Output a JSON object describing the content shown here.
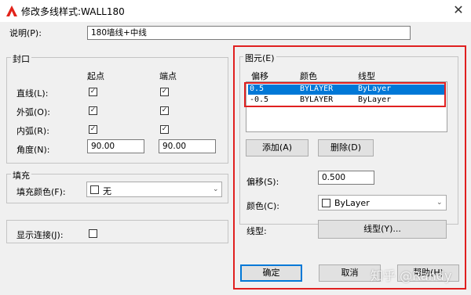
{
  "window": {
    "title": "修改多线样式:WALL180",
    "close_glyph": "✕"
  },
  "description": {
    "label": "说明(P):",
    "value": "180墙线+中线"
  },
  "caps": {
    "group_label": "封口",
    "col_start": "起点",
    "col_end": "端点",
    "rows": [
      {
        "label": "直线(L):",
        "start": true,
        "end": true
      },
      {
        "label": "外弧(O):",
        "start": true,
        "end": true
      },
      {
        "label": "内弧(R):",
        "start": true,
        "end": true
      }
    ],
    "angle": {
      "label": "角度(N):",
      "start": "90.00",
      "end": "90.00"
    }
  },
  "fill": {
    "group_label": "填充",
    "color_label": "填充颜色(F):",
    "color_value": "无"
  },
  "show_joints": {
    "label": "显示连接(J):",
    "checked": false
  },
  "elements": {
    "group_label": "图元(E)",
    "headers": {
      "offset": "偏移",
      "color": "颜色",
      "linetype": "线型"
    },
    "rows": [
      {
        "offset": "0.5",
        "color": "BYLAYER",
        "linetype": "ByLayer",
        "selected": true
      },
      {
        "offset": "-0.5",
        "color": "BYLAYER",
        "linetype": "ByLayer",
        "selected": false
      }
    ],
    "add_label": "添加(A)",
    "delete_label": "删除(D)",
    "offset_label": "偏移(S):",
    "offset_value": "0.500",
    "color_label": "颜色(C):",
    "color_value": "ByLayer",
    "linetype_label": "线型:",
    "linetype_button": "线型(Y)..."
  },
  "buttons": {
    "ok": "确定",
    "cancel": "取消",
    "help": "帮助(H)"
  },
  "watermark": "知乎 @Randy",
  "colors": {
    "highlight": "#0078d7",
    "annotation_red": "#e02020",
    "title_bg": "#ffffff",
    "dialog_bg": "#f0f0f0"
  },
  "icons": {
    "app": "autocad-logo-icon",
    "close": "close-icon",
    "dropdown": "chevron-down-icon",
    "check": "checkmark-icon"
  }
}
